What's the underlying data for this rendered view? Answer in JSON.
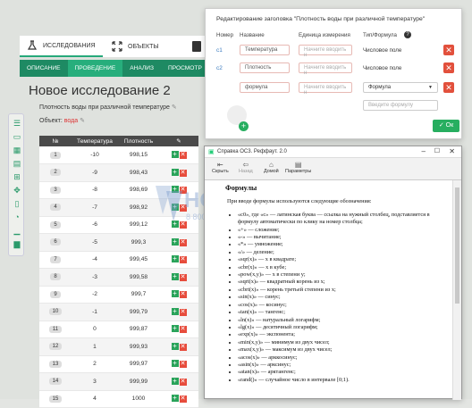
{
  "topbar": {
    "tabs": [
      {
        "label": "ИССЛЕДОВАНИЯ",
        "icon": "flask-icon"
      },
      {
        "label": "ОБЪЕКТЫ",
        "icon": "expand-icon"
      }
    ]
  },
  "nav": {
    "tabs": [
      "ОПИСАНИЕ",
      "ПРОВЕДЕНИЕ",
      "АНАЛИЗ",
      "ПРОСМОТР"
    ]
  },
  "page": {
    "title": "Новое исследование 2",
    "subtitle": "Плотность воды при различной температуре",
    "subject_label": "Объект:",
    "subject_value": "вода"
  },
  "table": {
    "headers": [
      "№",
      "Температура",
      "Плотность"
    ],
    "rows": [
      [
        "1",
        "-10",
        "998,15"
      ],
      [
        "2",
        "-9",
        "998,43"
      ],
      [
        "3",
        "-8",
        "998,69"
      ],
      [
        "4",
        "-7",
        "998,92"
      ],
      [
        "5",
        "-6",
        "999,12"
      ],
      [
        "6",
        "-5",
        "999,3"
      ],
      [
        "7",
        "-4",
        "999,45"
      ],
      [
        "8",
        "-3",
        "999,58"
      ],
      [
        "9",
        "-2",
        "999,7"
      ],
      [
        "10",
        "-1",
        "999,79"
      ],
      [
        "11",
        "0",
        "999,87"
      ],
      [
        "12",
        "1",
        "999,93"
      ],
      [
        "13",
        "2",
        "999,97"
      ],
      [
        "14",
        "3",
        "999,99"
      ],
      [
        "15",
        "4",
        "1000"
      ]
    ]
  },
  "modal": {
    "title": "Редактирование заголовка \"Плотность воды при различной температуре\"",
    "headers": {
      "num": "Номер",
      "name": "Название",
      "unit": "Единица измерения",
      "type": "Тип/Формула"
    },
    "rows": [
      {
        "num": "c1",
        "name": "Температура",
        "unit_placeholder": "Начните вводить н",
        "type": "Числовое поле"
      },
      {
        "num": "c2",
        "name": "Плотность",
        "unit_placeholder": "Начните вводить н",
        "type": "Числовое поле"
      },
      {
        "num": "",
        "name": "формула",
        "unit_placeholder": "Начните вводить н",
        "type": "Формула"
      }
    ],
    "formula_placeholder": "Введите формулу",
    "ok_label": "Ок"
  },
  "help": {
    "window_title": "Справка ОС3. Реффаут. 2.0",
    "tools": [
      "Скрыть",
      "Назад",
      "Домой",
      "Параметры"
    ],
    "heading": "Формулы",
    "intro": "При вводе формулы используются следующие обозначения:",
    "items": [
      "«с0», где «с» — латинская буква — ссылка на нужный столбец, подставляется в формулу автоматически по клику на номер столбца;",
      "«+» — сложение;",
      "«-» — вычитание;",
      "«*» — умножение;",
      "«/» — деление;",
      "«sqr(x)» — x в квадрате;",
      "«cbr(x)» — x в кубе;",
      "«pow(x,y)» — x в степени y;",
      "«sqrt(x)» — квадратный корень из x;",
      "«cbrt(x)» — корень третьей степени из x;",
      "«sin(x)» — синус;",
      "«cos(x)» — косинус;",
      "«tan(x)» — тангенс;",
      "«ln(x)» — натуральный логарифм;",
      "«lg(x)» — десятичный логарифм;",
      "«exp(x)» — экспонента;",
      "«min(x,y)» — минимум из двух чисел;",
      "«max(x,y)» — максимум из двух чисел;",
      "«acos(x)» — арккосинус;",
      "«asin(x)» — арксинус;",
      "«atan(x)» — арктангенс;",
      "«rand()» — случайное число в интервале [0;1)."
    ]
  },
  "colors": {
    "accent": "#27ae7c",
    "danger": "#e2503c",
    "link": "#3b7bbf"
  }
}
